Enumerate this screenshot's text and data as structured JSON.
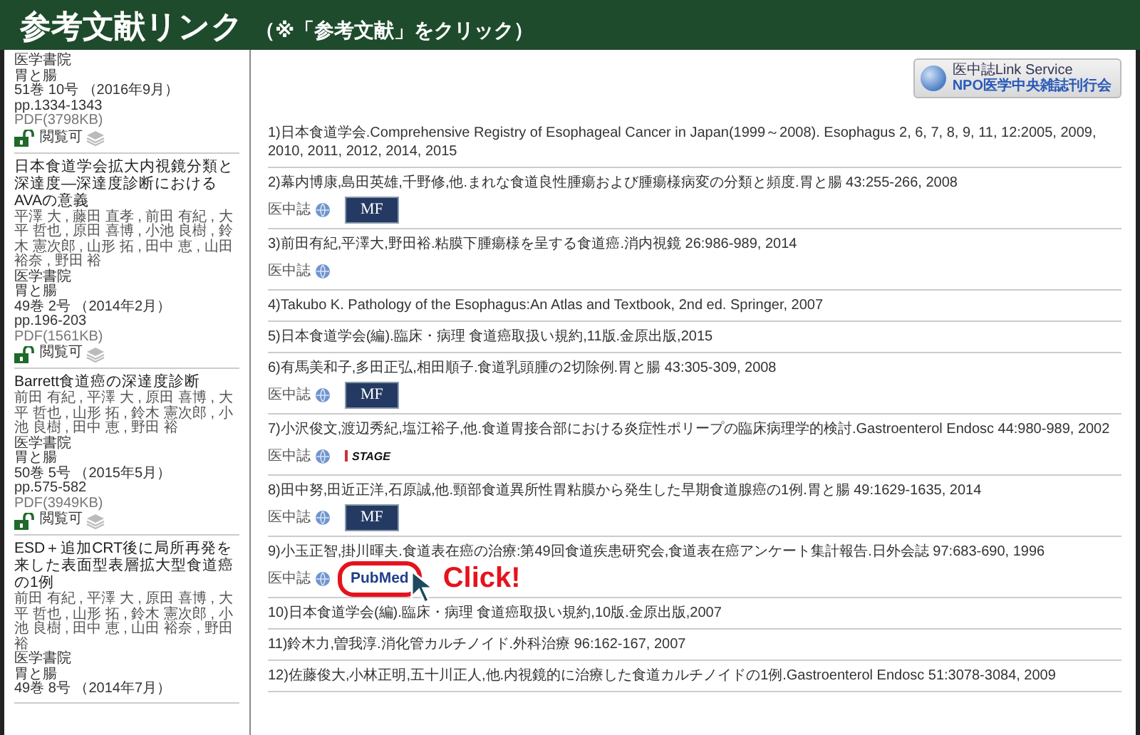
{
  "header": {
    "title": "参考文献リンク",
    "note": "（※「参考文献」をクリック）"
  },
  "sidebar": {
    "articles": [
      {
        "publisher": "医学書院",
        "journal": "胃と腸",
        "issue": "51巻 10号 （2016年9月）",
        "pages": "pp.1334-1343",
        "pdf": "PDF(3798KB)",
        "access": "閲覧可"
      },
      {
        "title": "日本食道学会拡大内視鏡分類と深達度―深達度診断におけるAVAの意義",
        "authors": "平澤 大 , 藤田 直孝 , 前田 有紀 , 大平 哲也 , 原田 喜博 , 小池 良樹 , 鈴木 憲次郎 , 山形 拓 , 田中 恵 , 山田裕奈 , 野田 裕",
        "publisher": "医学書院",
        "journal": "胃と腸",
        "issue": "49巻 2号 （2014年2月）",
        "pages": "pp.196-203",
        "pdf": "PDF(1561KB)",
        "access": "閲覧可"
      },
      {
        "title": "Barrett食道癌の深達度診断",
        "authors": "前田 有紀 , 平澤 大 , 原田 喜博 , 大平 哲也 , 山形 拓 , 鈴木 憲次郎 , 小池 良樹 , 田中 恵 , 野田 裕",
        "publisher": "医学書院",
        "journal": "胃と腸",
        "issue": "50巻 5号 （2015年5月）",
        "pages": "pp.575-582",
        "pdf": "PDF(3949KB)",
        "access": "閲覧可"
      },
      {
        "title": "ESD＋追加CRT後に局所再発を来した表面型表層拡大型食道癌の1例",
        "authors": "前田 有紀 , 平澤 大 , 原田 喜博 , 大平 哲也 , 山形 拓 , 鈴木 憲次郎 , 小池 良樹 , 田中 恵 , 山田 裕奈 , 野田裕",
        "publisher": "医学書院",
        "journal": "胃と腸",
        "issue": "49巻 8号 （2014年7月）"
      }
    ]
  },
  "service_logo": {
    "name": "医中誌Link Service",
    "org": "NPO医学中央雑誌刊行会"
  },
  "references": [
    {
      "text": "1)日本食道学会.Comprehensive Registry of Esophageal Cancer in Japan(1999～2008). Esophagus 2, 6, 7, 8, 9, 11, 12:2005, 2009, 2010, 2011, 2012, 2014, 2015"
    },
    {
      "text": "2)幕内博康,島田英雄,千野修,他.まれな食道良性腫瘍および腫瘍様病変の分類と頻度.胃と腸 43:255-266, 2008",
      "links": [
        {
          "kind": "ichushi",
          "label": "医中誌",
          "highlighted": false
        },
        {
          "kind": "mf",
          "label": "MF",
          "highlighted": false
        }
      ]
    },
    {
      "text": "3)前田有紀,平澤大,野田裕.粘膜下腫瘍様を呈する食道癌.消内視鏡 26:986-989, 2014",
      "links": [
        {
          "kind": "ichushi",
          "label": "医中誌",
          "highlighted": false
        }
      ]
    },
    {
      "text": "4)Takubo K. Pathology of the Esophagus:An Atlas and Textbook, 2nd ed. Springer, 2007"
    },
    {
      "text": "5)日本食道学会(編).臨床・病理 食道癌取扱い規約,11版.金原出版,2015"
    },
    {
      "text": "6)有馬美和子,多田正弘,相田順子.食道乳頭腫の2切除例.胃と腸 43:305-309, 2008",
      "links": [
        {
          "kind": "ichushi",
          "label": "医中誌",
          "highlighted": false
        },
        {
          "kind": "mf",
          "label": "MF",
          "highlighted": false
        }
      ]
    },
    {
      "text": "7)小沢俊文,渡辺秀紀,塩江裕子,他.食道胃接合部における炎症性ポリープの臨床病理学的検討.Gastroenterol Endosc 44:980-989, 2002",
      "links": [
        {
          "kind": "ichushi",
          "label": "医中誌",
          "highlighted": false
        },
        {
          "kind": "jstage",
          "label": "STAGE",
          "highlighted": false
        }
      ]
    },
    {
      "text": "8)田中努,田近正洋,石原誠,他.頸部食道異所性胃粘膜から発生した早期食道腺癌の1例.胃と腸 49:1629-1635, 2014",
      "links": [
        {
          "kind": "ichushi",
          "label": "医中誌",
          "highlighted": false
        },
        {
          "kind": "mf",
          "label": "MF",
          "highlighted": false
        }
      ]
    },
    {
      "text": "9)小玉正智,掛川暉夫.食道表在癌の治療:第49回食道疾患研究会,食道表在癌アンケート集計報告.日外会誌 97:683-690, 1996",
      "links": [
        {
          "kind": "ichushi",
          "label": "医中誌",
          "highlighted": false
        },
        {
          "kind": "pubmed",
          "label": "PubMed",
          "highlighted": true,
          "callout": "Click!"
        }
      ]
    },
    {
      "text": "10)日本食道学会(編).臨床・病理 食道癌取扱い規約,10版.金原出版,2007"
    },
    {
      "text": "11)鈴木力,曽我淳.消化管カルチノイド.外科治療 96:162-167, 2007"
    },
    {
      "text": "12)佐藤俊大,小林正明,五十川正人,他.内視鏡的に治療した食道カルチノイドの1例.Gastroenterol Endosc 51:3078-3084, 2009"
    }
  ]
}
